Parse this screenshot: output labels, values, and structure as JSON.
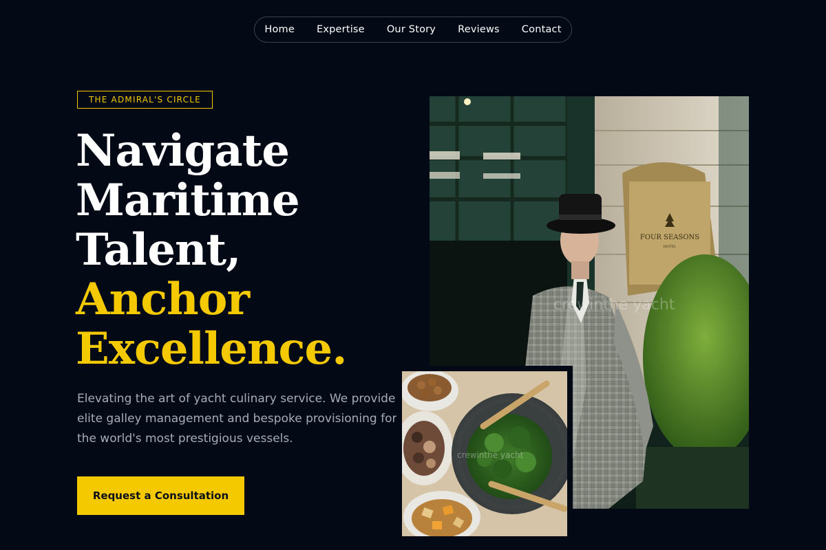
{
  "nav": {
    "items": [
      "Home",
      "Expertise",
      "Our Story",
      "Reviews",
      "Contact"
    ]
  },
  "hero": {
    "badge": "THE ADMIRAL'S CIRCLE",
    "headline_white": [
      "Navigate",
      "Maritime",
      "Talent,"
    ],
    "headline_gold": [
      "Anchor",
      "Excellence."
    ],
    "lead": "Elevating the art of yacht culinary service. We provide elite galley management and bespoke provisioning for the world's most prestigious vessels.",
    "cta_label": "Request a Consultation"
  },
  "images": {
    "main_sign_text": "FOUR SEASONS",
    "main_sign_subtext": "HOTEL",
    "main_watermark": "crewinthe yacht",
    "food_watermark": "crewinthe yacht"
  },
  "colors": {
    "background": "#030a16",
    "accent": "#f5c900",
    "text_muted": "#a6adb9"
  }
}
